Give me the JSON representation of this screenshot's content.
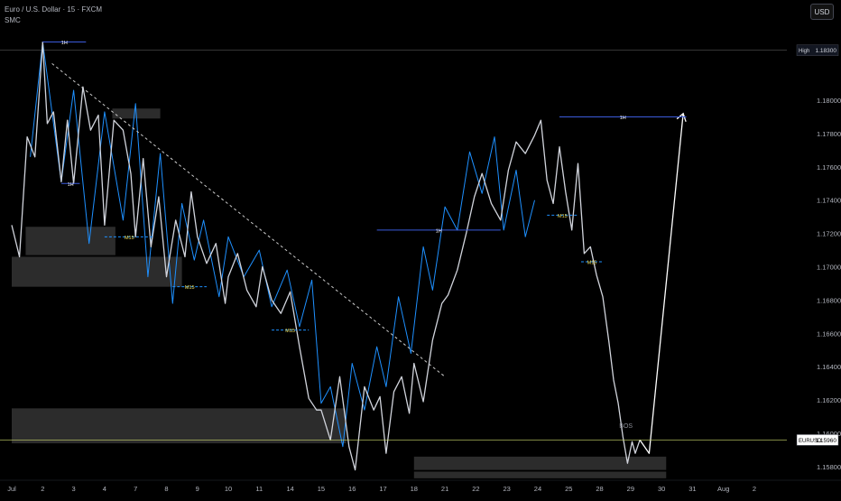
{
  "header": {
    "symbol_line": "Euro / U.S. Dollar · 15 · FXCM",
    "indicator": "SMC",
    "currency_button": "USD"
  },
  "colors": {
    "background": "#000000",
    "price": "#d1d4dc",
    "swing": "#1e90ff",
    "bos": "#3b5bdb",
    "zone": "#4a4a4a",
    "projection": "#ffffff",
    "trendline": "#cccccc",
    "m15_label": "#f2e05a",
    "last_price_line": "#c8d66b"
  },
  "chart_data": {
    "type": "line",
    "title": "Euro / U.S. Dollar · 15 · FXCM",
    "ylim": [
      1.1574,
      1.1845
    ],
    "y_ticks": [
      "1.18300",
      "1.18000",
      "1.17800",
      "1.17600",
      "1.17400",
      "1.17200",
      "1.17000",
      "1.16800",
      "1.16600",
      "1.16400",
      "1.16200",
      "1.16000",
      "1.15800"
    ],
    "y_tick_values": [
      1.183,
      1.18,
      1.178,
      1.176,
      1.174,
      1.172,
      1.17,
      1.168,
      1.166,
      1.164,
      1.162,
      1.16,
      1.158
    ],
    "x_ticks": [
      "Jul",
      "2",
      "3",
      "4",
      "7",
      "8",
      "9",
      "10",
      "11",
      "14",
      "15",
      "16",
      "17",
      "18",
      "21",
      "22",
      "23",
      "24",
      "25",
      "28",
      "29",
      "30",
      "31",
      "Aug",
      "2"
    ],
    "x_tick_index": [
      0,
      1,
      2,
      3,
      4,
      5,
      6,
      7,
      8,
      9,
      10,
      11,
      12,
      13,
      14,
      15,
      16,
      17,
      18,
      19,
      20,
      21,
      22,
      23,
      24
    ],
    "x_unit": "trading session index (0 = Jul 1)",
    "series": [
      {
        "kind": "price",
        "x": [
          0,
          0.25,
          0.5,
          0.75,
          1,
          1.15,
          1.35,
          1.6,
          1.8,
          2,
          2.3,
          2.55,
          2.8,
          3,
          3.3,
          3.6,
          3.85,
          4,
          4.25,
          4.5,
          4.75,
          5,
          5.3,
          5.6,
          5.8,
          6,
          6.3,
          6.6,
          6.9,
          7,
          7.3,
          7.6,
          7.9,
          8.1,
          8.4,
          8.7,
          9,
          9.3,
          9.6,
          9.85,
          10,
          10.3,
          10.6,
          10.9,
          11.1,
          11.4,
          11.7,
          11.9,
          12.1,
          12.35,
          12.6,
          12.85,
          13,
          13.3,
          13.6,
          13.9,
          14.1,
          14.4,
          14.7,
          14.95,
          15.2,
          15.5,
          15.8,
          16.05,
          16.3,
          16.6,
          16.9,
          17.1,
          17.3,
          17.5,
          17.7,
          17.9,
          18.1,
          18.3,
          18.5,
          18.7,
          18.9,
          19.1,
          19.3,
          19.45,
          19.6,
          19.75,
          19.9,
          20.05,
          20.15,
          20.3
        ],
        "y": [
          1.1725,
          1.1706,
          1.1778,
          1.1766,
          1.1835,
          1.1786,
          1.1793,
          1.1751,
          1.1788,
          1.175,
          1.1808,
          1.1782,
          1.1791,
          1.1725,
          1.1788,
          1.1782,
          1.1756,
          1.1718,
          1.1765,
          1.1712,
          1.1742,
          1.1694,
          1.1728,
          1.1706,
          1.1745,
          1.1718,
          1.1702,
          1.1714,
          1.1678,
          1.1694,
          1.1708,
          1.1686,
          1.1676,
          1.17,
          1.168,
          1.1672,
          1.1685,
          1.1652,
          1.1621,
          1.1614,
          1.1614,
          1.1596,
          1.1634,
          1.1592,
          1.1578,
          1.1628,
          1.1614,
          1.1622,
          1.1588,
          1.1625,
          1.1634,
          1.1612,
          1.1642,
          1.1619,
          1.1656,
          1.1678,
          1.1683,
          1.1698,
          1.1721,
          1.1742,
          1.1756,
          1.1738,
          1.1728,
          1.1758,
          1.1775,
          1.1768,
          1.1779,
          1.1788,
          1.1752,
          1.1738,
          1.1772,
          1.1745,
          1.1722,
          1.1762,
          1.1708,
          1.1712,
          1.1695,
          1.1682,
          1.1655,
          1.1632,
          1.1618,
          1.1598,
          1.1582,
          1.1595,
          1.1588,
          1.1596
        ]
      },
      {
        "kind": "projection",
        "x": [
          20.3,
          20.6,
          21.7
        ],
        "y": [
          1.1596,
          1.1588,
          1.1792
        ]
      },
      {
        "kind": "trendline",
        "x": [
          1.3,
          14
        ],
        "y": [
          1.1822,
          1.1634
        ]
      },
      {
        "kind": "swing",
        "x": [
          0.6,
          1,
          1.6,
          2,
          2.5,
          3,
          3.6,
          4,
          4.4,
          4.8,
          5.2,
          5.5,
          5.9,
          6.2,
          6.7,
          7,
          7.5,
          8,
          8.4,
          8.9,
          9.3,
          9.7,
          10,
          10.3,
          10.7,
          11,
          11.4,
          11.8,
          12.1,
          12.5,
          12.9,
          13.3,
          13.6,
          14,
          14.4,
          14.8,
          15.2,
          15.6,
          15.9,
          16.3,
          16.6,
          16.9
        ],
        "y": [
          1.1766,
          1.1835,
          1.1751,
          1.1806,
          1.1714,
          1.1793,
          1.1728,
          1.1798,
          1.1694,
          1.1768,
          1.1678,
          1.1738,
          1.1704,
          1.1728,
          1.1682,
          1.1718,
          1.1694,
          1.171,
          1.1676,
          1.1698,
          1.1664,
          1.1692,
          1.1618,
          1.1628,
          1.1592,
          1.1642,
          1.1614,
          1.1652,
          1.1628,
          1.1682,
          1.1648,
          1.1712,
          1.1686,
          1.1736,
          1.1722,
          1.1769,
          1.1744,
          1.1778,
          1.1722,
          1.1758,
          1.1718,
          1.174
        ]
      }
    ],
    "annotations": [
      {
        "type": "level",
        "label": "1H",
        "x1": 1,
        "x2": 2.4,
        "y": 1.1835
      },
      {
        "type": "level",
        "label": "1H",
        "x1": 1.6,
        "x2": 2.2,
        "y": 1.175
      },
      {
        "type": "level",
        "label": "1H",
        "x1": 11.8,
        "x2": 15.8,
        "y": 1.1722
      },
      {
        "type": "level",
        "label": "1H",
        "x1": 17.7,
        "x2": 21.8,
        "y": 1.179
      },
      {
        "type": "level",
        "label": "M15",
        "x1": 3,
        "x2": 4.6,
        "y": 1.1718
      },
      {
        "type": "level",
        "label": "M15",
        "x1": 5.2,
        "x2": 6.3,
        "y": 1.1688
      },
      {
        "type": "level",
        "label": "M15",
        "x1": 8.4,
        "x2": 9.6,
        "y": 1.1662
      },
      {
        "type": "level",
        "label": "M15",
        "x1": 17.3,
        "x2": 18.3,
        "y": 1.1731
      },
      {
        "type": "level",
        "label": "M15",
        "x1": 18.4,
        "x2": 19.1,
        "y": 1.1703
      },
      {
        "type": "label",
        "label": "BOS",
        "x": 19.85,
        "y": 1.1599
      }
    ],
    "zones": [
      {
        "x1": 0.45,
        "x2": 3.35,
        "y1": 1.1724,
        "y2": 1.1707
      },
      {
        "x1": 0,
        "x2": 5.5,
        "y1": 1.1706,
        "y2": 1.1688
      },
      {
        "x1": 3.25,
        "x2": 4.8,
        "y1": 1.1795,
        "y2": 1.1789
      },
      {
        "x1": 0,
        "x2": 10.8,
        "y1": 1.1615,
        "y2": 1.1594
      },
      {
        "x1": 13,
        "x2": 21.15,
        "y1": 1.1586,
        "y2": 1.1578
      },
      {
        "x1": 13,
        "x2": 21.15,
        "y1": 1.1577,
        "y2": 1.1573
      }
    ],
    "price_labels": [
      {
        "name": "High",
        "value": "1.18300",
        "y": 1.183
      },
      {
        "name": "EURUSD",
        "value": "1.15960",
        "y": 1.1596
      }
    ],
    "grid": false,
    "legend": "none"
  }
}
